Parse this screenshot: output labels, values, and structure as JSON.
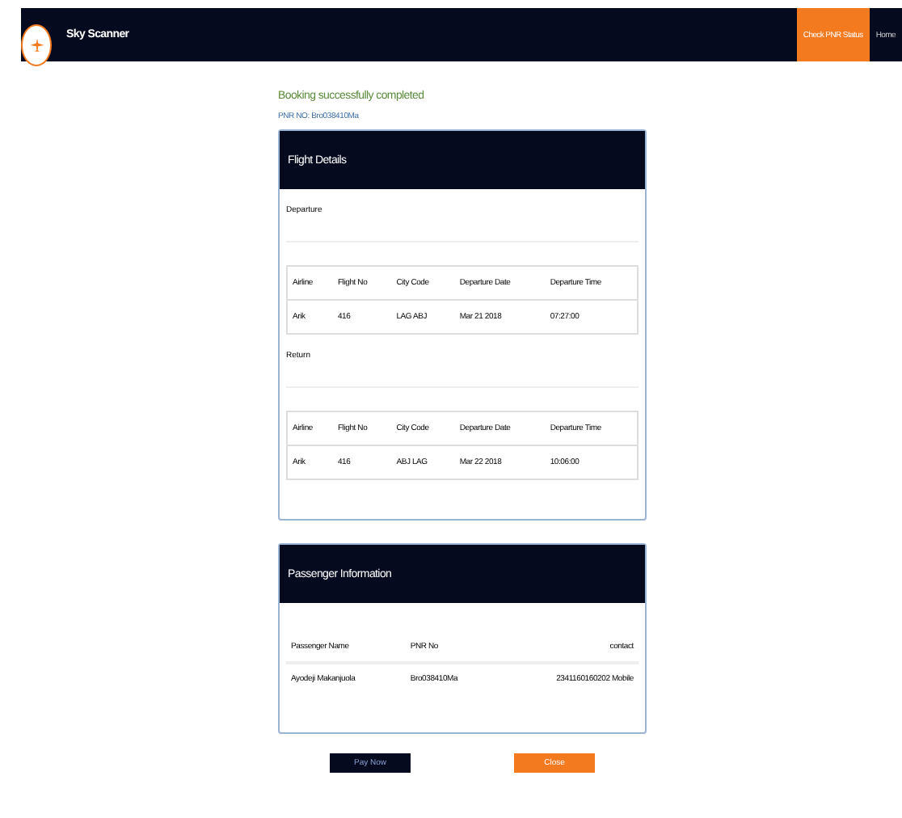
{
  "header": {
    "brand": "Sky Scanner",
    "nav": [
      {
        "label": "Check PNR Status",
        "selected": true
      },
      {
        "label": "Home",
        "selected": false
      }
    ]
  },
  "message": "Booking successfully completed",
  "pnr_line": "PNR NO: Bro038410Ma",
  "flight_details": {
    "title": "Flight Details",
    "legs": [
      {
        "label": "Departure",
        "columns": [
          "Airline",
          "Flight No",
          "City Code",
          "Departure Date",
          "Departure Time"
        ],
        "row": [
          "Arik",
          "416",
          "LAG ABJ",
          "Mar 21 2018",
          "07:27:00"
        ]
      },
      {
        "label": "Return",
        "columns": [
          "Airline",
          "Flight No",
          "City Code",
          "Departure Date",
          "Departure Time"
        ],
        "row": [
          "Arik",
          "416",
          "ABJ LAG",
          "Mar 22 2018",
          "10:06:00"
        ]
      }
    ]
  },
  "passenger_info": {
    "title": "Passenger Information",
    "columns": [
      "Passenger Name",
      "PNR No",
      "contact"
    ],
    "row": [
      "Ayodeji Makanjuola",
      "Bro038410Ma",
      "2341160160202 Mobile"
    ]
  },
  "buttons": [
    {
      "label": "Pay Now",
      "kind": "primary"
    },
    {
      "label": "Close",
      "kind": "accent"
    }
  ]
}
